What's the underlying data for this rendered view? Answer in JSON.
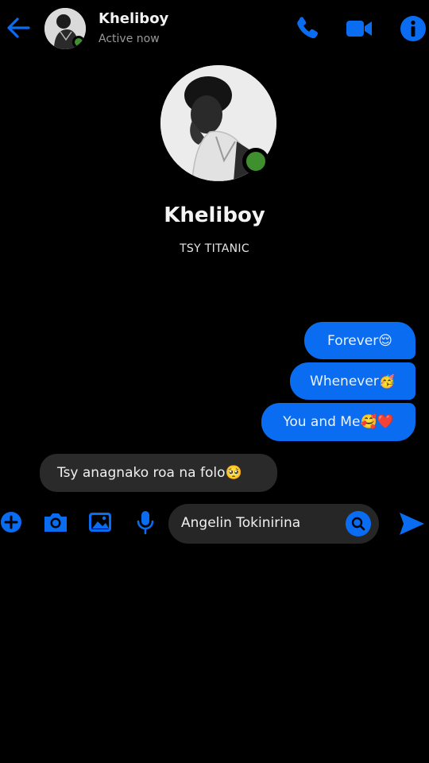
{
  "header": {
    "name": "Kheliboy",
    "status": "Active now"
  },
  "profile": {
    "name": "Kheliboy",
    "subtitle": "TSY TITANIC"
  },
  "messages": [
    {
      "direction": "outgoing",
      "text": "Forever",
      "emoji": "😌"
    },
    {
      "direction": "outgoing",
      "text": "Whenever",
      "emoji": "🥳"
    },
    {
      "direction": "outgoing",
      "text": "You and Me",
      "emoji": "🥰❤️"
    },
    {
      "direction": "incoming",
      "text": "Tsy anagnako roa na folo",
      "emoji": "🥺"
    }
  ],
  "composer": {
    "value": "Angelin Tokinirina"
  },
  "icons": {
    "back": "arrow-left-icon",
    "call": "phone-icon",
    "video": "video-camera-icon",
    "info": "info-icon",
    "plus": "plus-icon",
    "camera": "camera-icon",
    "gallery": "image-icon",
    "mic": "microphone-icon",
    "emoji": "search-icon",
    "send": "send-icon"
  },
  "colors": {
    "accent": "#0a6cf0",
    "online": "#3f8f2f",
    "background": "#000000",
    "incoming_bubble": "#2a2a2a"
  }
}
